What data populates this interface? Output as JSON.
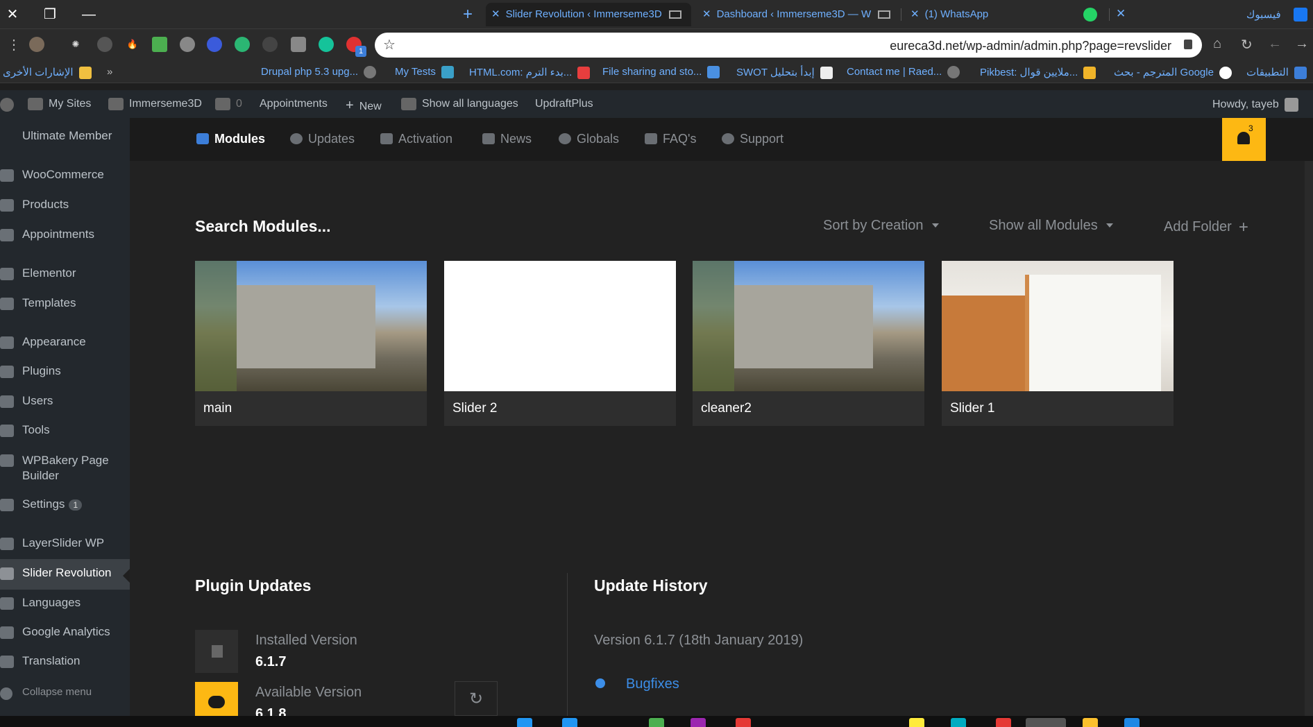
{
  "browser": {
    "tabs": [
      {
        "title": "Slider Revolution ‹ Immerseme3D",
        "active": true
      },
      {
        "title": "Dashboard ‹ Immerseme3D — W",
        "active": false
      },
      {
        "title": "(1) WhatsApp",
        "active": false
      }
    ],
    "facebook_tab": "فيسبوك",
    "new_tab": "+",
    "url": "eureca3d.net/wp-admin/admin.php?page=revslider",
    "extension_badge": "1"
  },
  "bookmarks": [
    {
      "label": "التطبيقات",
      "color": "#3c7ed9"
    },
    {
      "label": "المترجم - بحث Google",
      "color": "#ffffff"
    },
    {
      "label": "Pikbest: ملايين قوال...",
      "color": "#f0b429"
    },
    {
      "label": "Contact me | Raed...",
      "color": "#777777"
    },
    {
      "label": "SWOT إبدأ بتحليل",
      "color": "#eeeeee"
    },
    {
      "label": "File sharing and sto...",
      "color": "#4a90e2"
    },
    {
      "label": "HTML.com: بدء الترم...",
      "color": "#e83e3e"
    },
    {
      "label": "My Tests",
      "color": "#3aa0c8"
    },
    {
      "label": "Drupal php 5.3 upg...",
      "color": "#777777"
    },
    {
      "label": "الإشارات الأخرى",
      "color": "#f0c040"
    }
  ],
  "bookmarks_overflow": "»",
  "adminbar": {
    "my_sites": "My Sites",
    "site_name": "Immerseme3D",
    "comments": "0",
    "appointments": "Appointments",
    "new": "New",
    "languages": "Show all languages",
    "updraft": "UpdraftPlus",
    "howdy": "Howdy, tayeb"
  },
  "sidebar": {
    "items": [
      {
        "label": "Ultimate Member"
      },
      {
        "label": "WooCommerce"
      },
      {
        "label": "Products"
      },
      {
        "label": "Appointments"
      },
      {
        "label": "Elementor"
      },
      {
        "label": "Templates"
      },
      {
        "label": "Appearance"
      },
      {
        "label": "Plugins"
      },
      {
        "label": "Users"
      },
      {
        "label": "Tools"
      },
      {
        "label": "WPBakery Page Builder"
      },
      {
        "label": "Settings",
        "badge": "1"
      },
      {
        "label": "LayerSlider WP"
      },
      {
        "label": "Slider Revolution",
        "active": true
      },
      {
        "label": "Languages"
      },
      {
        "label": "Google Analytics"
      },
      {
        "label": "Translation"
      },
      {
        "label": "Collapse menu"
      }
    ]
  },
  "revnav": {
    "items": [
      "Modules",
      "Updates",
      "Activation",
      "News",
      "Globals",
      "FAQ's",
      "Support"
    ],
    "notifications": "3"
  },
  "modules": {
    "title": "Search Modules...",
    "sort": "Sort by Creation",
    "filter": "Show all Modules",
    "add_folder": "Add Folder",
    "cards": [
      {
        "label": "main",
        "thumb": "villa"
      },
      {
        "label": "Slider 2",
        "thumb": "blank"
      },
      {
        "label": "cleaner2",
        "thumb": "villa"
      },
      {
        "label": "Slider 1",
        "thumb": "modern"
      }
    ]
  },
  "plugin_updates": {
    "title": "Plugin Updates",
    "installed_label": "Installed Version",
    "installed_value": "6.1.7",
    "available_label": "Available Version",
    "available_value": "6.1.8"
  },
  "update_history": {
    "title": "Update History",
    "version": "Version 6.1.7 (18th January 2019)",
    "section": "Bugfixes"
  },
  "colors": {
    "accent": "#3c7ed9",
    "bell": "#fdb813",
    "link": "#3c8ee8"
  }
}
